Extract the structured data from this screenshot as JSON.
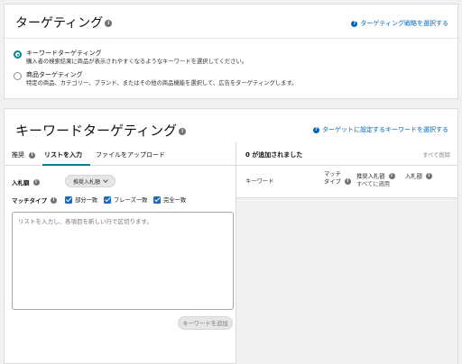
{
  "targeting": {
    "title": "ターゲティング",
    "strategy_link": "ターゲティング戦略を選択する",
    "options": [
      {
        "label": "キーワードターゲティング",
        "desc": "購入者の検索結果に商品が表示されやすくなるようなキーワードを選択してください。",
        "selected": true
      },
      {
        "label": "商品ターゲティング",
        "desc": "特定の商品、カテゴリー、ブランド、またはその他の商品機能を選択して、広告をターゲティングします。",
        "selected": false
      }
    ]
  },
  "keyword_targeting": {
    "title": "キーワードターゲティング",
    "link": "ターゲットに設定するキーワードを選択する",
    "tabs": [
      "推奨",
      "リストを入力",
      "ファイルをアップロード"
    ],
    "active_tab": 1,
    "bid_label": "入札額",
    "bid_button": "推奨入札額",
    "match_type_label": "マッチタイプ",
    "match_types": [
      {
        "label": "部分一致",
        "checked": true
      },
      {
        "label": "フレーズ一致",
        "checked": true
      },
      {
        "label": "完全一致",
        "checked": true
      }
    ],
    "textarea_placeholder": "リストを入力し、各項目を新しい行で区切ります。",
    "add_button": "キーワードを追加",
    "added_count": "0 が追加されました",
    "clear_all": "すべて削除",
    "columns": {
      "keyword": "キーワード",
      "match_type_1": "マッチ",
      "match_type_2": "タイプ",
      "suggested_bid": "推奨入札額",
      "apply_all": "すべてに適用",
      "bid": "入札額"
    }
  },
  "colors": {
    "accent": "#008296",
    "link": "#0066c0",
    "checkbox": "#1c6bb7"
  }
}
